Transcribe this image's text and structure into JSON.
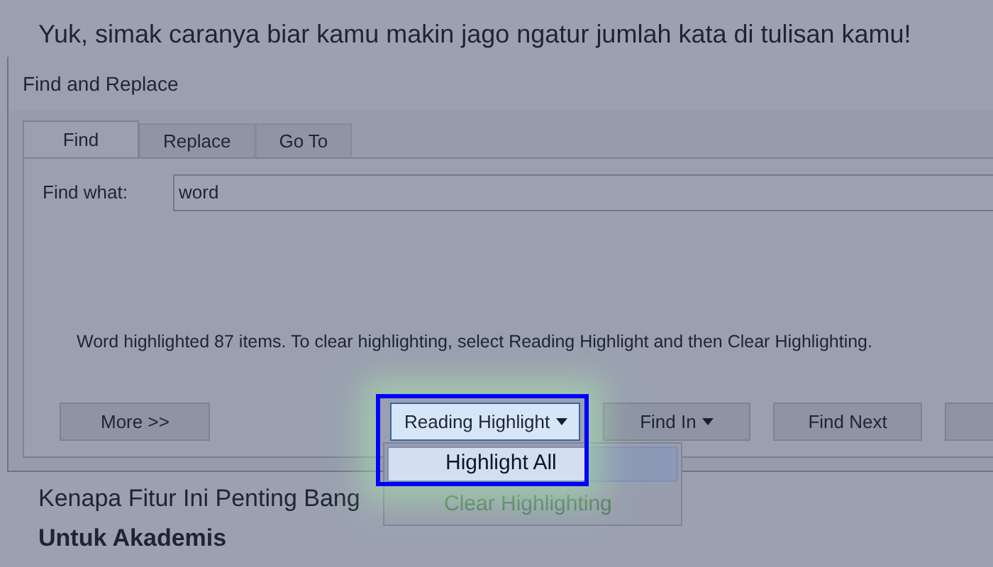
{
  "heading": "Yuk, simak caranya biar kamu makin jago ngatur jumlah kata di tulisan kamu!",
  "dialog": {
    "title": "Find and Replace",
    "tabs": [
      {
        "label": "Find",
        "selected": true
      },
      {
        "label": "Replace",
        "selected": false
      },
      {
        "label": "Go To",
        "selected": false
      }
    ],
    "find_what": {
      "label": "Find what:",
      "value": "word"
    },
    "message": "Word highlighted 87 items. To clear highlighting, select Reading Highlight and then Clear Highlighting.",
    "buttons": [
      {
        "label": "More >>",
        "kind": "button",
        "focused": false
      },
      {
        "label": "Reading Highlight",
        "kind": "dropdown",
        "focused": true
      },
      {
        "label": "Find In",
        "kind": "dropdown",
        "focused": false
      },
      {
        "label": "Find Next",
        "kind": "button",
        "focused": false
      }
    ],
    "menu": {
      "items": [
        {
          "label": "Highlight All",
          "selected": true
        },
        {
          "label": "Clear Highlighting",
          "selected": false
        }
      ]
    }
  },
  "body": [
    {
      "kind": "paragraph",
      "text": "Kenapa Fitur Ini Penting Bang"
    },
    {
      "kind": "subheading",
      "text": "Untuk Akademis"
    }
  ]
}
